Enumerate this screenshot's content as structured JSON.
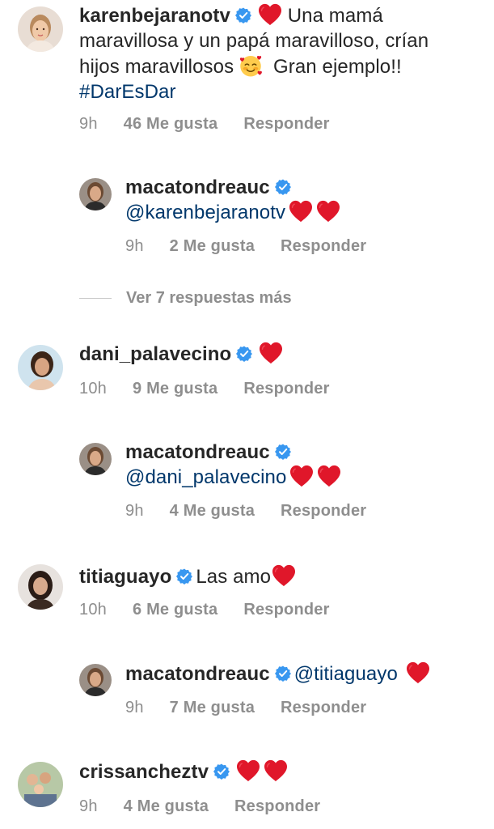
{
  "colors": {
    "text": "#262626",
    "meta": "#8e8e8e",
    "link": "#00376b",
    "verified": "#3897f0",
    "heart": "#e0172a"
  },
  "icons": {
    "verified": "verified-badge-icon",
    "heart": "red-heart-emoji",
    "blush": "smiling-face-with-hearts-emoji"
  },
  "comments": [
    {
      "username": "karenbejaranotv",
      "text_line1": "Una mamá",
      "text_line2": "maravillosa y un papá maravilloso, crían",
      "text_line3a": "hijos maravillosos",
      "text_line3b": "Gran ejemplo!!",
      "hashtag": "#DarEsDar",
      "time": "9h",
      "likes": "46 Me gusta",
      "reply": "Responder"
    },
    {
      "username": "macatondreauc",
      "mention": "@karenbejaranotv",
      "time": "9h",
      "likes": "2 Me gusta",
      "reply": "Responder"
    },
    {
      "username": "dani_palavecino",
      "time": "10h",
      "likes": "9 Me gusta",
      "reply": "Responder"
    },
    {
      "username": "macatondreauc",
      "mention": "@dani_palavecino",
      "time": "9h",
      "likes": "4 Me gusta",
      "reply": "Responder"
    },
    {
      "username": "titiaguayo",
      "text": "Las amo",
      "time": "10h",
      "likes": "6 Me gusta",
      "reply": "Responder"
    },
    {
      "username": "macatondreauc",
      "mention": "@titiaguayo",
      "time": "9h",
      "likes": "7 Me gusta",
      "reply": "Responder"
    },
    {
      "username": "crissancheztv",
      "time": "9h",
      "likes": "4 Me gusta",
      "reply": "Responder"
    }
  ],
  "view_more": "Ver 7 respuestas más"
}
